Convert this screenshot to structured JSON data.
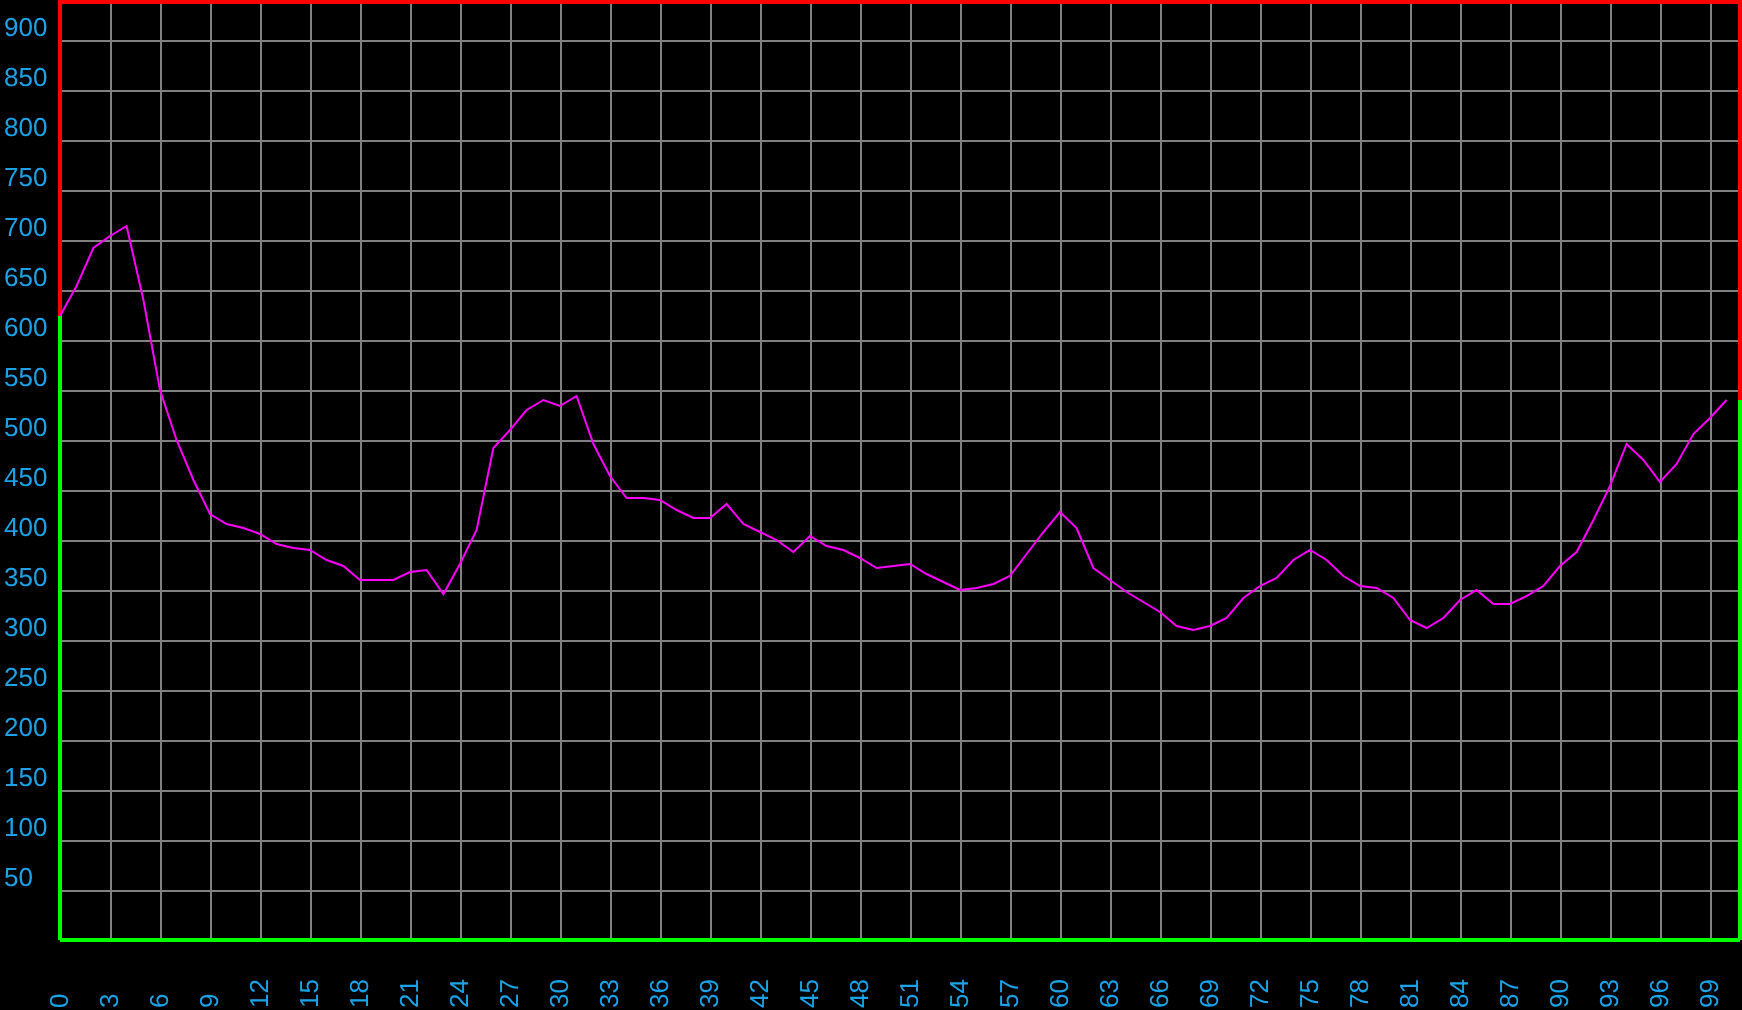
{
  "chart_data": {
    "type": "line",
    "grid": true,
    "xlim": [
      0,
      100.8
    ],
    "ylim": [
      0,
      940
    ],
    "x": [
      0,
      1,
      2,
      3,
      4,
      5,
      6,
      7,
      8,
      9,
      10,
      11,
      12,
      13,
      14,
      15,
      16,
      17,
      18,
      19,
      20,
      21,
      22,
      23,
      24,
      25,
      26,
      27,
      28,
      29,
      30,
      31,
      32,
      33,
      34,
      35,
      36,
      37,
      38,
      39,
      40,
      41,
      42,
      43,
      44,
      45,
      46,
      47,
      48,
      49,
      50,
      51,
      52,
      53,
      54,
      55,
      56,
      57,
      58,
      59,
      60,
      61,
      62,
      63,
      64,
      65,
      66,
      67,
      68,
      69,
      70,
      71,
      72,
      73,
      74,
      75,
      76,
      77,
      78,
      79,
      80,
      81,
      82,
      83,
      84,
      85,
      86,
      87,
      88,
      89,
      90,
      91,
      92,
      93,
      94,
      95,
      96,
      97,
      98,
      99,
      100
    ],
    "xticks": [
      0,
      3,
      6,
      9,
      12,
      15,
      18,
      21,
      24,
      27,
      30,
      33,
      36,
      39,
      42,
      45,
      48,
      51,
      54,
      57,
      60,
      63,
      66,
      69,
      72,
      75,
      78,
      81,
      84,
      87,
      90,
      93,
      96,
      99
    ],
    "yticks": [
      50,
      100,
      150,
      200,
      250,
      300,
      350,
      400,
      450,
      500,
      550,
      600,
      650,
      700,
      750,
      800,
      850,
      900
    ],
    "series": [
      {
        "color": "#ff00ff",
        "values": [
          624,
          654,
          692,
          704,
          714,
          640,
          550,
          500,
          460,
          426,
          416,
          412,
          406,
          396,
          392,
          390,
          380,
          374,
          360,
          360,
          360,
          368,
          370,
          346,
          376,
          410,
          492,
          510,
          530,
          540,
          534,
          544,
          496,
          464,
          442,
          442,
          440,
          430,
          422,
          422,
          436,
          416,
          408,
          400,
          388,
          404,
          394,
          390,
          382,
          372,
          374,
          376,
          366,
          358,
          350,
          352,
          356,
          364,
          386,
          408,
          428,
          412,
          372,
          360,
          348,
          338,
          328,
          314,
          310,
          314,
          322,
          342,
          354,
          362,
          380,
          390,
          380,
          364,
          354,
          352,
          342,
          320,
          312,
          322,
          340,
          350,
          336,
          336,
          344,
          354,
          374,
          388,
          420,
          454,
          496,
          480,
          458,
          476,
          506,
          522,
          540
        ]
      }
    ]
  }
}
